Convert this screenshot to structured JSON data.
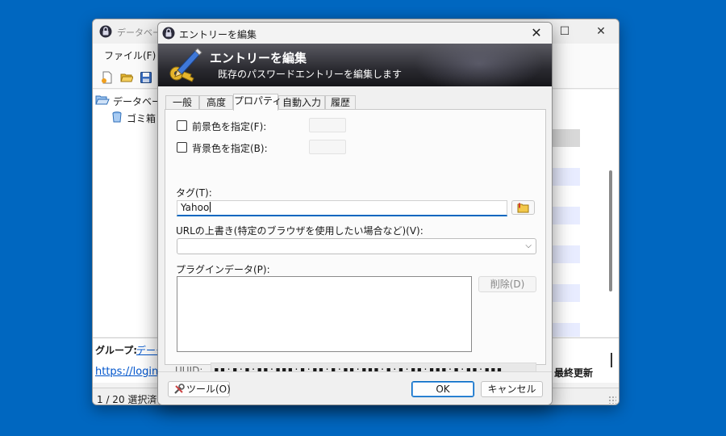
{
  "main_window": {
    "title": "データベース",
    "menu": {
      "file": "ファイル(F)"
    },
    "tree": {
      "root": "データベース",
      "recycle_bin": "ゴミ箱"
    },
    "details": {
      "group_label": "グループ:",
      "group_value": "データ",
      "url": "https://login",
      "last_modified": "最終更新"
    },
    "status": "1 / 20 選択済"
  },
  "dialog": {
    "title": "エントリーを編集",
    "banner": {
      "title": "エントリーを編集",
      "subtitle": "既存のパスワードエントリーを編集します"
    },
    "tabs": [
      {
        "label": "一般"
      },
      {
        "label": "高度"
      },
      {
        "label": "プロパティ",
        "active": true
      },
      {
        "label": "自動入力"
      },
      {
        "label": "履歴"
      }
    ],
    "properties": {
      "fg_color_label": "前景色を指定(F):",
      "bg_color_label": "背景色を指定(B):",
      "tags_label": "タグ(T):",
      "tags_value": "Yahoo",
      "url_override_label": "URLの上書き(特定のブラウザを使用したい場合など)(V):",
      "url_override_value": "",
      "plugin_data_label": "プラグインデータ(P):",
      "delete_button": "削除(D)",
      "uuid_label": "UUID:",
      "uuid_value": "▪▪·▪·▪·▪▪·▪▪▪·▪·▪▪·▪·▪▪·▪▪▪·▪·▪·▪▪·▪▪▪·▪·▪▪·▪▪▪"
    },
    "footer": {
      "tools": "ツール(O)",
      "ok": "OK",
      "cancel": "キャンセル"
    }
  }
}
